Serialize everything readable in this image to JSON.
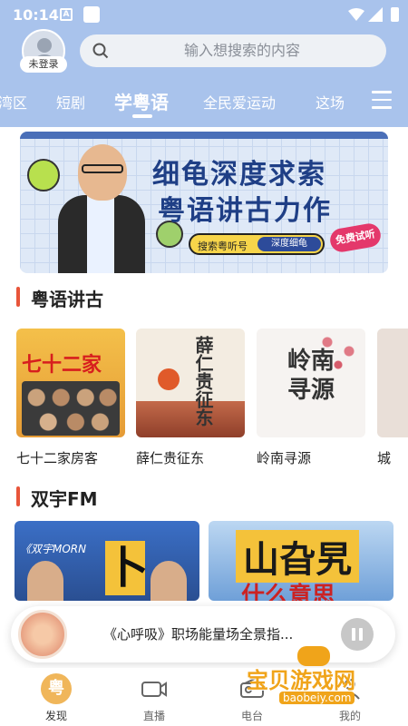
{
  "statusbar": {
    "time": "10:14",
    "a_label": "A"
  },
  "header": {
    "login_label": "未登录",
    "search_placeholder": "输入想搜索的内容",
    "tabs": [
      {
        "label": "湾区"
      },
      {
        "label": "短剧"
      },
      {
        "label": "学粤语",
        "active": true
      },
      {
        "label": "全民爱运动"
      },
      {
        "label": "这场"
      }
    ]
  },
  "banner": {
    "title_line1": "细龟深度求索",
    "title_line2": "粤语讲古力作",
    "search_hint": "搜索粤听号",
    "search_term": "深度细龟",
    "badge": "免费试听"
  },
  "sections": {
    "gushi": {
      "title": "粤语讲古",
      "albums": [
        {
          "name": "七十二家房客",
          "cover_text": "七十二家"
        },
        {
          "name": "薛仁贵征东",
          "cover_text": "薛仁贵征东"
        },
        {
          "name": "岭南寻源",
          "cover_text": "岭南寻源"
        },
        {
          "name": "城"
        }
      ]
    },
    "fm": {
      "title": "双宇FM",
      "cards": [
        {
          "overlay_text": "《双宇MORN",
          "big_letter": "卜"
        },
        {
          "big_text": "山旮旯",
          "sub_text": "什么意思"
        }
      ]
    }
  },
  "player": {
    "title": "《心呼吸》职场能量场全景指..."
  },
  "bottomnav": {
    "items": [
      {
        "label": "发现",
        "icon_text": "粤",
        "active": true
      },
      {
        "label": "直播"
      },
      {
        "label": "电台"
      },
      {
        "label": "我的"
      }
    ]
  },
  "watermark": {
    "text": "宝贝游戏网",
    "url": "baobeiy.com"
  },
  "colors": {
    "header_bg": "#a9c3ec",
    "accent": "#e8553a",
    "nav_active": "#f0b65a"
  }
}
